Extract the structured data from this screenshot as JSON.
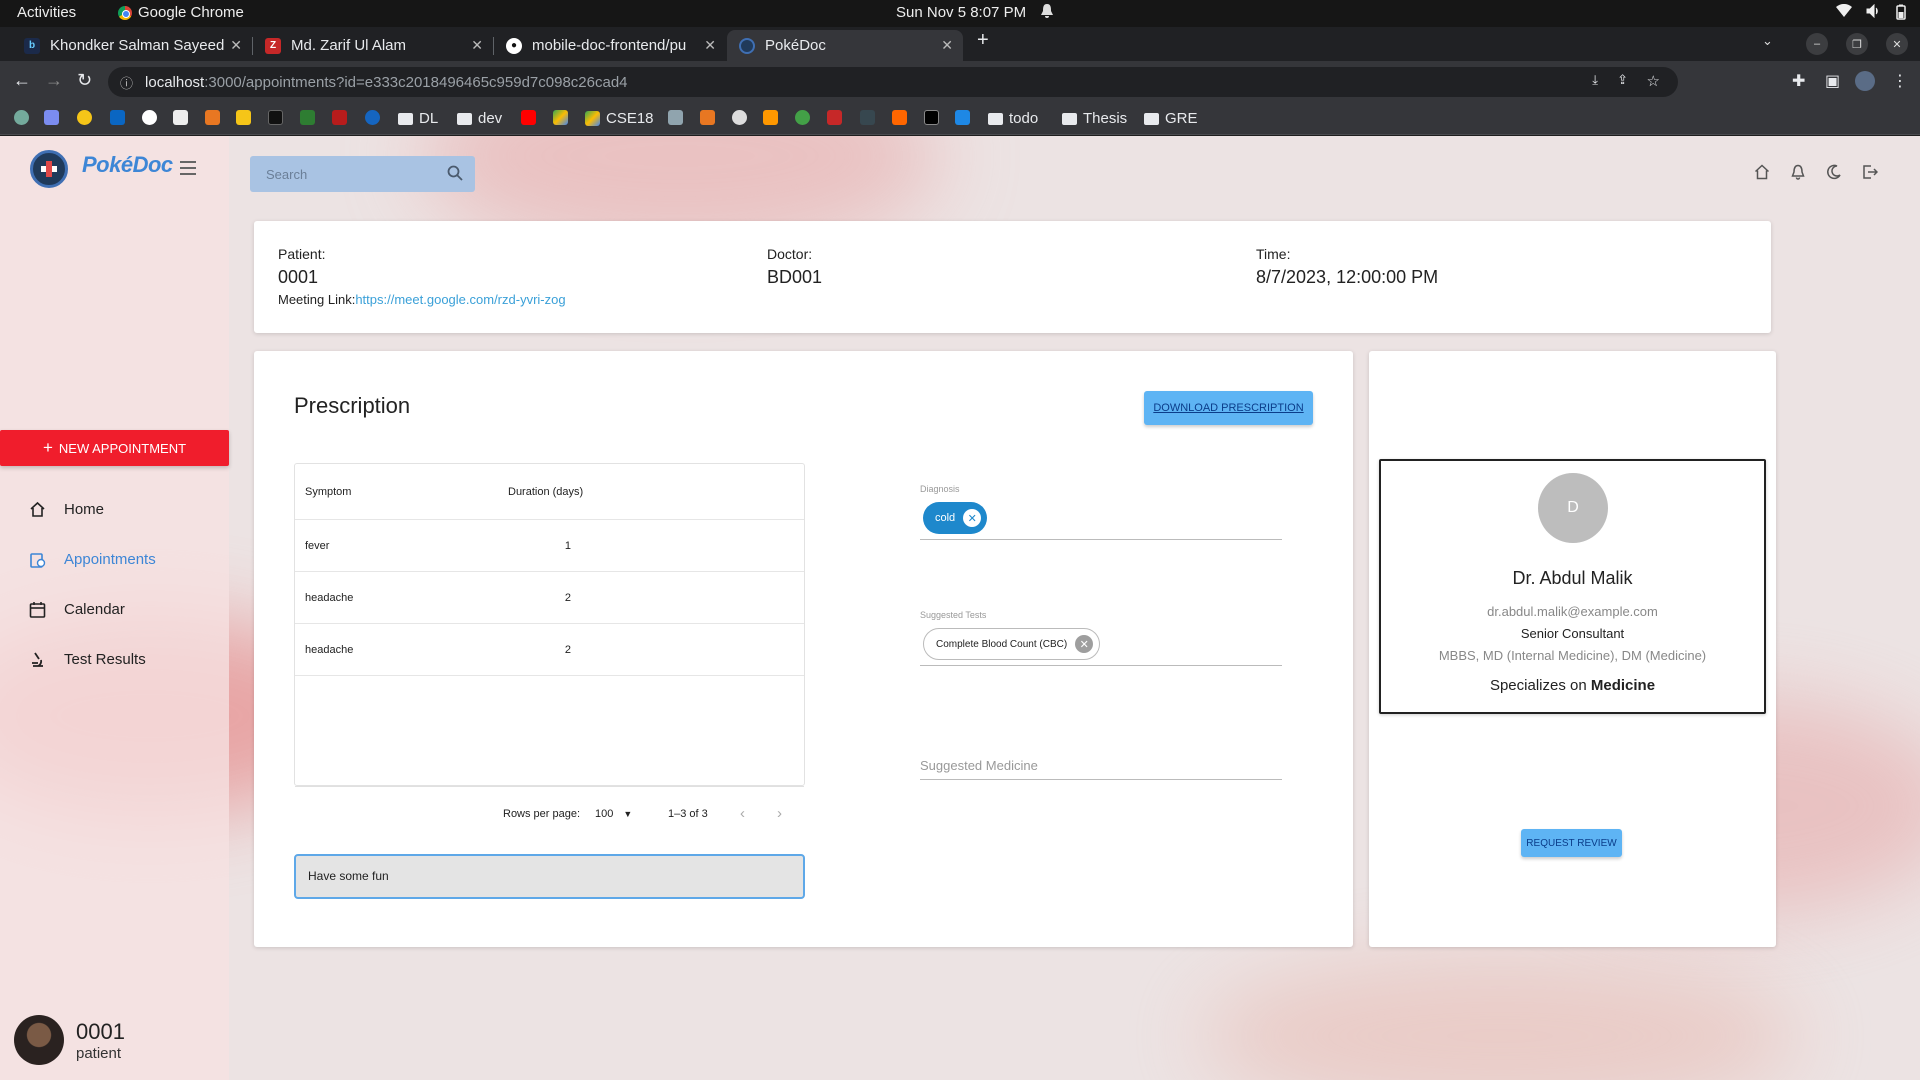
{
  "os": {
    "activities": "Activities",
    "app_name": "Google Chrome",
    "clock": "Sun Nov 5   8:07 PM"
  },
  "browser": {
    "tabs": [
      {
        "title": "Khondker Salman Sayeed",
        "active": false
      },
      {
        "title": "Md. Zarif Ul Alam",
        "active": false
      },
      {
        "title": "mobile-doc-frontend/pu",
        "active": false
      },
      {
        "title": "PokéDoc",
        "active": true
      }
    ],
    "url_host": "localhost",
    "url_rest": ":3000/appointments?id=e333c2018496465c959d7c098c26cad4",
    "bookmarks": [
      "DL",
      "dev",
      "CSE18",
      "todo",
      "Thesis",
      "GRE"
    ]
  },
  "app": {
    "brand": "PokéDoc",
    "search_placeholder": "Search",
    "new_appointment": "NEW APPOINTMENT",
    "nav": [
      {
        "label": "Home",
        "icon": "home-icon",
        "active": false
      },
      {
        "label": "Appointments",
        "icon": "appointments-icon",
        "active": true
      },
      {
        "label": "Calendar",
        "icon": "calendar-icon",
        "active": false
      },
      {
        "label": "Test Results",
        "icon": "microscope-icon",
        "active": false
      }
    ],
    "user": {
      "name": "0001",
      "role": "patient"
    }
  },
  "appointment": {
    "patient_label": "Patient:",
    "patient": "0001",
    "doctor_label": "Doctor:",
    "doctor": "BD001",
    "time_label": "Time:",
    "time": "8/7/2023, 12:00:00 PM",
    "meeting_label": "Meeting Link:",
    "meeting_link": "https://meet.google.com/rzd-yvri-zog"
  },
  "prescription": {
    "title": "Prescription",
    "download": "DOWNLOAD PRESCRIPTION",
    "columns": [
      "Symptom",
      "Duration (days)"
    ],
    "rows": [
      {
        "symptom": "fever",
        "duration": "1"
      },
      {
        "symptom": "headache",
        "duration": "2"
      },
      {
        "symptom": "headache",
        "duration": "2"
      }
    ],
    "rows_per_page_label": "Rows per page:",
    "rows_per_page": "100",
    "pagination": "1–3 of 3",
    "note": "Have some fun",
    "diagnosis_label": "Diagnosis",
    "diagnosis": [
      "cold"
    ],
    "tests_label": "Suggested Tests",
    "tests": [
      "Complete Blood Count (CBC)"
    ],
    "medicine_placeholder": "Suggested Medicine"
  },
  "doctor_card": {
    "initial": "D",
    "name": "Dr. Abdul Malik",
    "email": "dr.abdul.malik@example.com",
    "position": "Senior Consultant",
    "degrees": "MBBS, MD (Internal Medicine), DM (Medicine)",
    "specializes_prefix": "Specializes on",
    "specialty": "Medicine",
    "request_review": "REQUEST REVIEW"
  },
  "colors": {
    "accent": "#3d86d6",
    "new_appointment": "#f01d2c",
    "button": "#5eb4f4",
    "chip": "#1e88cc"
  }
}
